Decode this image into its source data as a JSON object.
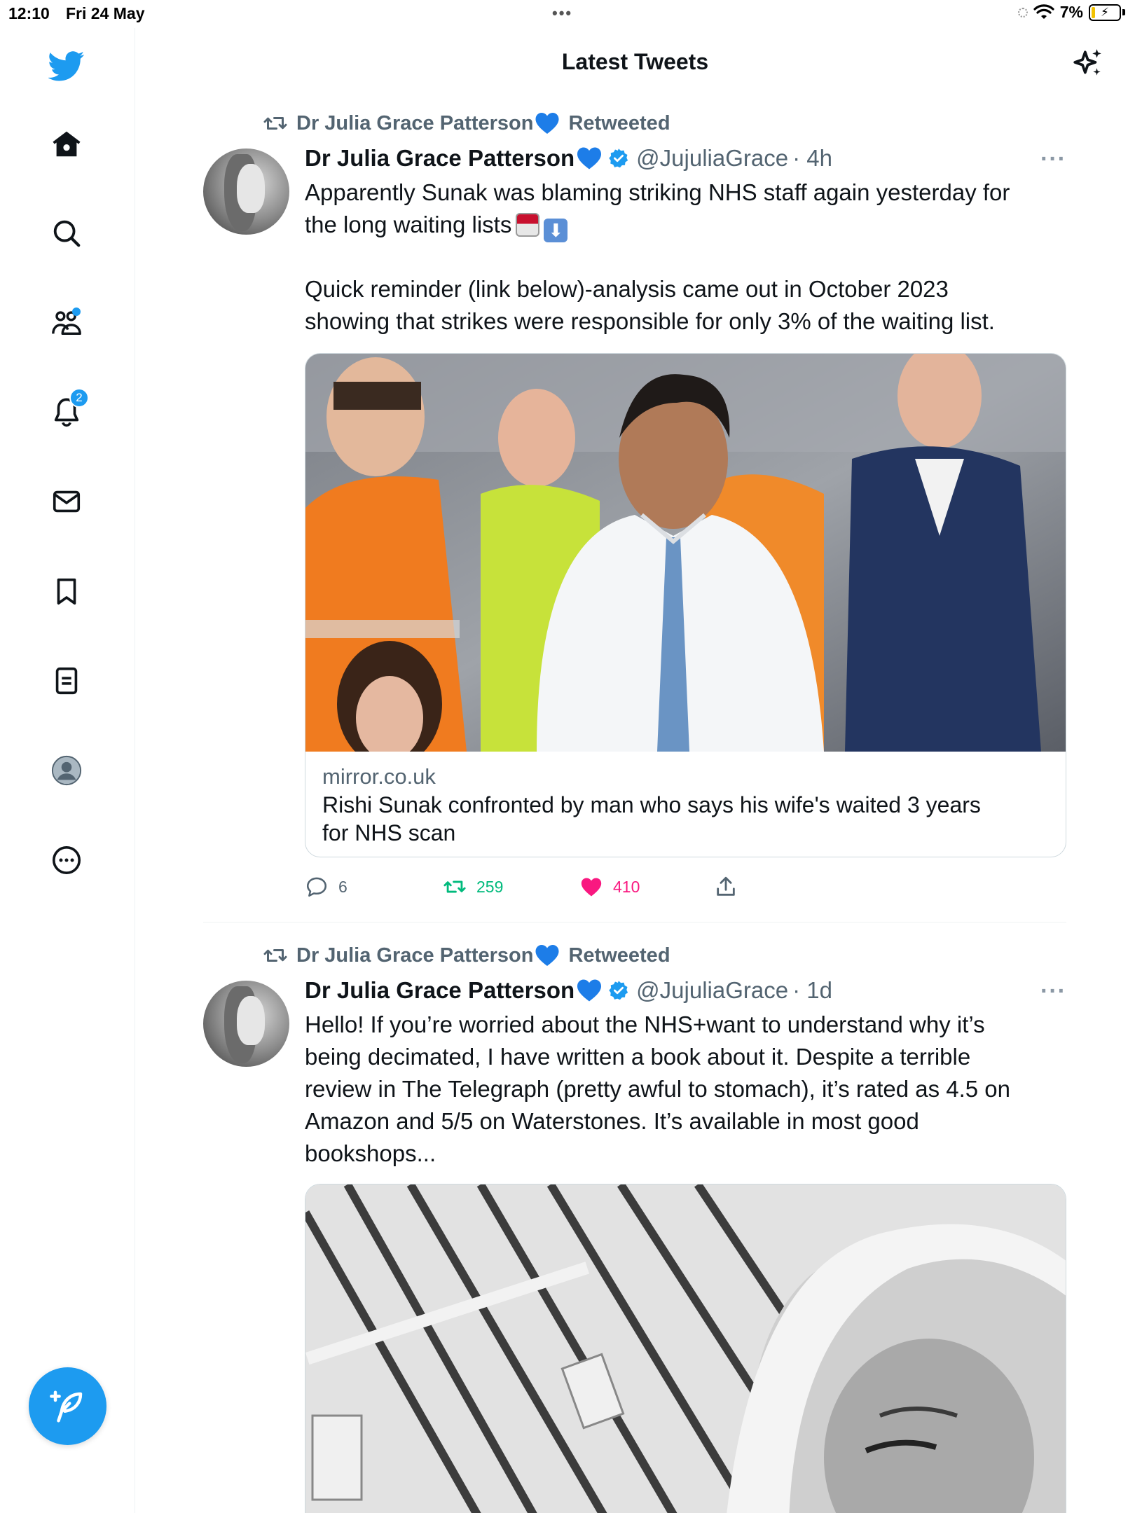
{
  "status_bar": {
    "time": "12:10",
    "date": "Fri 24 May",
    "battery_percent": "7%"
  },
  "header": {
    "title": "Latest Tweets"
  },
  "sidebar": {
    "items": [
      {
        "name": "home",
        "icon": "home-icon"
      },
      {
        "name": "search",
        "icon": "search-icon"
      },
      {
        "name": "communities",
        "icon": "communities-icon"
      },
      {
        "name": "notifications",
        "icon": "bell-icon",
        "badge": "2"
      },
      {
        "name": "messages",
        "icon": "mail-icon"
      },
      {
        "name": "bookmarks",
        "icon": "bookmark-icon"
      },
      {
        "name": "lists",
        "icon": "lists-icon"
      },
      {
        "name": "profile",
        "icon": "profile-icon"
      },
      {
        "name": "more",
        "icon": "more-circle-icon"
      }
    ]
  },
  "colors": {
    "accent": "#1d9bf0",
    "retweet": "#00ba7c",
    "like": "#f91880",
    "secondary_text": "#536471"
  },
  "tweets": [
    {
      "retweeted_by": "Dr Julia Grace Patterson",
      "retweeted_label": "Retweeted",
      "name": "Dr Julia Grace Patterson",
      "handle": "@JujuliaGrace",
      "time": "· 4h",
      "more": "···",
      "text_1": "Apparently Sunak was blaming striking NHS staff again yesterday for\nthe long waiting lists",
      "text_2": "Quick reminder (link below)-analysis came out in October 2023\nshowing that strikes were responsible for only 3% of the waiting list.",
      "card": {
        "domain": "mirror.co.uk",
        "headline": "Rishi Sunak confronted by man who says his wife's waited 3 years\nfor NHS scan"
      },
      "replies": "6",
      "retweets": "259",
      "likes": "410"
    },
    {
      "retweeted_by": "Dr Julia Grace Patterson",
      "retweeted_label": "Retweeted",
      "name": "Dr Julia Grace Patterson",
      "handle": "@JujuliaGrace",
      "time": "· 1d",
      "more": "···",
      "text": "Hello! If you’re worried about the NHS+want to understand why it’s\nbeing decimated, I have written a book about it. Despite a terrible\nreview in The Telegraph (pretty awful to stomach), it’s rated as 4.5 on\nAmazon and 5/5 on Waterstones. It’s available in most good\nbookshops..."
    }
  ]
}
